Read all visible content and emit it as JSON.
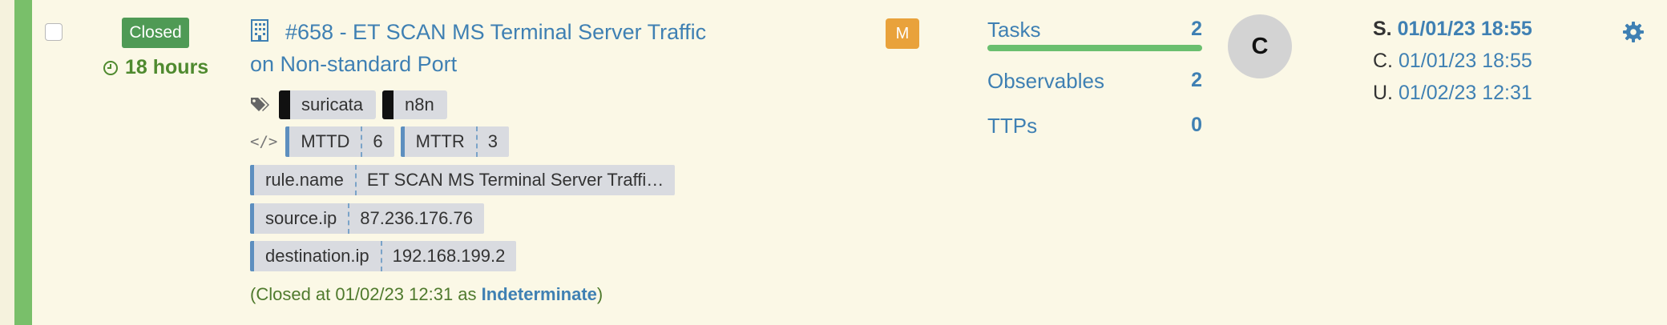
{
  "case": {
    "status": "Closed",
    "age": "18 hours",
    "title": "#658 - ET SCAN MS Terminal Server Traffic on Non-standard Port",
    "severity": "M",
    "tags": [
      "suricata",
      "n8n"
    ],
    "metrics": [
      {
        "key": "MTTD",
        "value": "6"
      },
      {
        "key": "MTTR",
        "value": "3"
      }
    ],
    "fields": [
      {
        "key": "rule.name",
        "value": "ET SCAN MS Terminal Server Traffi…"
      },
      {
        "key": "source.ip",
        "value": "87.236.176.76"
      },
      {
        "key": "destination.ip",
        "value": "192.168.199.2"
      }
    ],
    "closed_note": {
      "prefix": "(Closed at 01/02/23 12:31 as ",
      "resolution": "Indeterminate",
      "suffix": ")"
    }
  },
  "stats": {
    "tasks": {
      "label": "Tasks",
      "count": "2",
      "progress": 1.0
    },
    "observables": {
      "label": "Observables",
      "count": "2"
    },
    "ttps": {
      "label": "TTPs",
      "count": "0"
    }
  },
  "assignee": {
    "initial": "C"
  },
  "dates": {
    "start": {
      "prefix": "S.",
      "value": "01/01/23 18:55"
    },
    "created": {
      "prefix": "C.",
      "value": "01/01/23 18:55"
    },
    "updated": {
      "prefix": "U.",
      "value": "01/02/23 12:31"
    }
  },
  "icons": {
    "clock": "clock-icon",
    "building": "building-icon",
    "tags": "tags-icon",
    "code": "code-icon",
    "gear": "gear-icon"
  },
  "colors": {
    "status_bar": "#79bf6a",
    "closed_badge": "#4f9a55",
    "severity": "#e9a23b",
    "link": "#3f80b3",
    "progress": "#6abf6f",
    "background": "#fbf8e6"
  }
}
